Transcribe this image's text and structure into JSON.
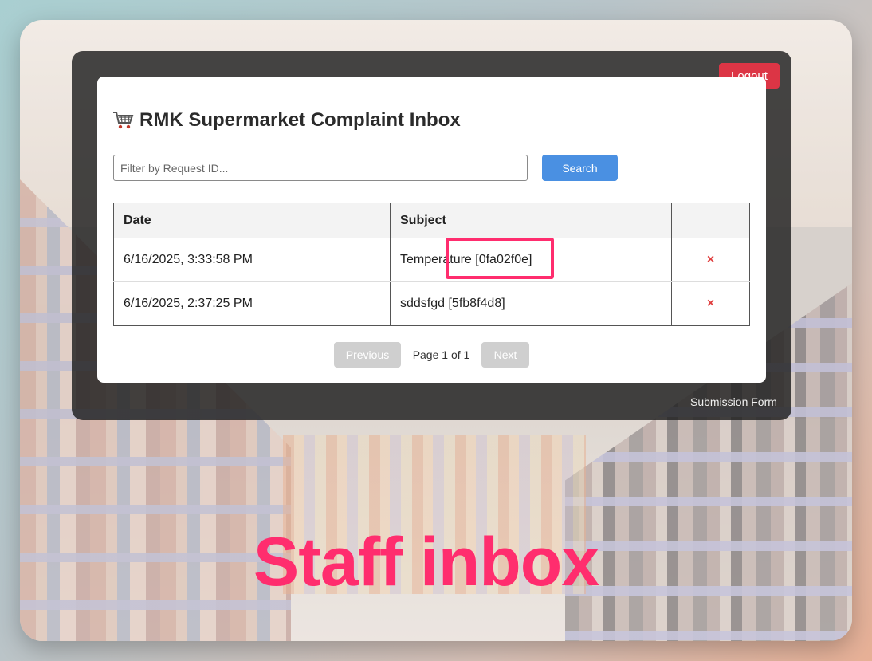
{
  "header": {
    "title": "RMK Supermarket Complaint Inbox",
    "logout_label": "Logout"
  },
  "filter": {
    "placeholder": "Filter by Request ID...",
    "search_label": "Search"
  },
  "table": {
    "columns": [
      "Date",
      "Subject",
      ""
    ],
    "rows": [
      {
        "date": "6/16/2025, 3:33:58 PM",
        "subject": "Temperature [0fa02f0e]",
        "action": "×"
      },
      {
        "date": "6/16/2025, 2:37:25 PM",
        "subject": "sddsfgd [5fb8f4d8]",
        "action": "×"
      }
    ]
  },
  "pagination": {
    "previous_label": "Previous",
    "page_info": "Page 1 of 1",
    "next_label": "Next"
  },
  "footer": {
    "submission_link": "Submission Form"
  },
  "caption": "Staff inbox",
  "colors": {
    "accent_red": "#dc3545",
    "search_blue": "#4a90e2",
    "highlight_pink": "#ff2d6e"
  },
  "icons": {
    "title_icon": "shopping-cart-icon",
    "delete_icon": "close-x-icon"
  }
}
